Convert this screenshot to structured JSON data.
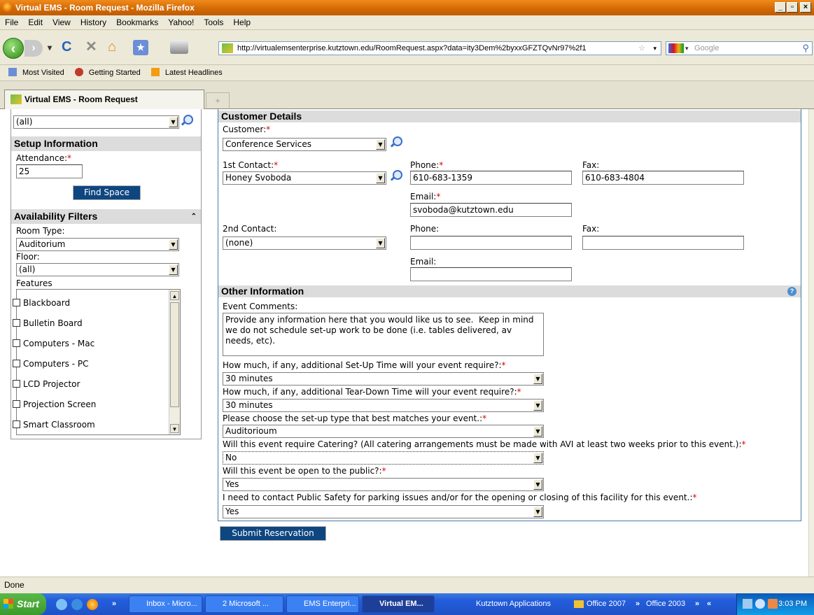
{
  "window": {
    "title": "Virtual EMS - Room Request - Mozilla Firefox"
  },
  "menu": [
    "File",
    "Edit",
    "View",
    "History",
    "Bookmarks",
    "Yahoo!",
    "Tools",
    "Help"
  ],
  "nav": {
    "url": "http://virtualemsenterprise.kutztown.edu/RoomRequest.aspx?data=ity3Dem%2byxxGFZTQvNr97%2f1",
    "search_placeholder": "Google"
  },
  "bookmarks": [
    "Most Visited",
    "Getting Started",
    "Latest Headlines"
  ],
  "tab": {
    "title": "Virtual EMS - Room Request",
    "new_tab": "+"
  },
  "left": {
    "top_select": "(all)",
    "setup": {
      "header": "Setup Information",
      "attendance_label": "Attendance:",
      "attendance_value": "25",
      "find_button": "Find Space"
    },
    "filters": {
      "header": "Availability Filters",
      "room_type_label": "Room Type:",
      "room_type_value": "Auditorium",
      "floor_label": "Floor:",
      "floor_value": "(all)",
      "features_label": "Features",
      "features": [
        "Blackboard",
        "Bulletin Board",
        "Computers - Mac",
        "Computers - PC",
        "LCD Projector",
        "Projection Screen",
        "Smart Classroom"
      ]
    }
  },
  "customer": {
    "header": "Customer Details",
    "customer_label": "Customer:",
    "customer_value": "Conference Services",
    "contact1_label": "1st Contact:",
    "contact1_value": "Honey Svoboda",
    "phone1_label": "Phone:",
    "phone1_value": "610-683-1359",
    "fax1_label": "Fax:",
    "fax1_value": "610-683-4804",
    "email1_label": "Email:",
    "email1_value": "svoboda@kutztown.edu",
    "contact2_label": "2nd Contact:",
    "contact2_value": "(none)",
    "phone2_label": "Phone:",
    "phone2_value": "",
    "fax2_label": "Fax:",
    "fax2_value": "",
    "email2_label": "Email:",
    "email2_value": ""
  },
  "other": {
    "header": "Other Information",
    "comments_label": "Event Comments:",
    "comments_value": "Provide any information here that you would like us to see.  Keep in mind we do not schedule set-up work to be done (i.e. tables delivered, av needs, etc).",
    "q_setup_label": "How much, if any, additional Set-Up Time will your event require?:",
    "q_setup_value": "30 minutes",
    "q_teardown_label": "How much, if any, additional Tear-Down Time will your event require?:",
    "q_teardown_value": "30 minutes",
    "q_type_label": "Please choose the set-up type that best matches your event.:",
    "q_type_value": "Auditorioum",
    "q_catering_label": "Will this event require Catering? (All catering arrangements must be made with AVI at least two weeks prior to this event.):",
    "q_catering_value": "No",
    "q_public_label": "Will this event be open to the public?:",
    "q_public_value": "Yes",
    "q_safety_label": "I need to contact Public Safety for parking issues and/or for the opening or closing of this facility for this event.:",
    "q_safety_value": "Yes",
    "submit": "Submit Reservation",
    "required_mark": "*"
  },
  "status": "Done",
  "taskbar": {
    "start": "Start",
    "items": [
      "Inbox - Micro...",
      "2 Microsoft ...",
      "EMS Enterpri...",
      "Virtual EM..."
    ],
    "quicklaunch_more": "»",
    "links": [
      "Kutztown Applications",
      "Office 2007",
      "Office 2003"
    ],
    "chevron_right": "»",
    "chevron_left": "«",
    "time": "3:03 PM"
  }
}
